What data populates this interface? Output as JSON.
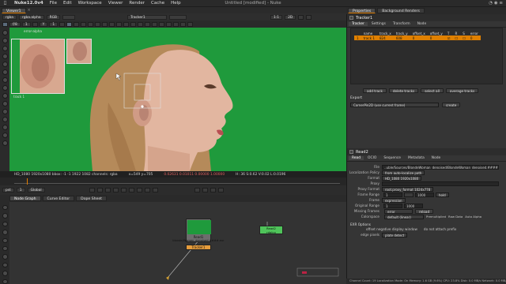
{
  "mac": {
    "app": "Nuke12.0v4",
    "menus": [
      "File",
      "Edit",
      "Workspace",
      "Viewer",
      "Render",
      "Cache",
      "Help"
    ],
    "window_title": "Untitled [modified] - Nuke"
  },
  "viewer": {
    "tab": "Viewer1",
    "channels": "rgba",
    "alpha": "rgba.alpha",
    "rgb": "RGB",
    "view_input": "Tracker1",
    "zoom": "1:1",
    "gamma": "f/8",
    "exposure": "1",
    "gain_label": "Y",
    "gain_value": "1",
    "error_label": "error-alpha",
    "info": [
      "HD_1080 1920x1080  bbox: -1 -1 1922 1082 channels: rgba",
      "x=549 y=705",
      "0.02631 0.01011 0.00000 1.00000",
      "H: 36 S:0.62 V:0.02 L:0.0196"
    ],
    "track_label": "track 1",
    "frame_label": "pst",
    "range": "Global",
    "frame": "1"
  },
  "nodegraph": {
    "tabs": [
      "Node Graph",
      "Curve Editor",
      "Dope Sheet"
    ],
    "read_node": {
      "label": "Read1",
      "sub": "blonde/Women_denoised.####.exr"
    },
    "tracker_node": "Tracker1",
    "viewer_node": {
      "label": "Read2",
      "sub": "rdalco"
    }
  },
  "properties": {
    "tabs": [
      "Properties",
      "Background Renders"
    ],
    "tracker": {
      "name": "Tracker1",
      "subtabs": [
        "Tracker",
        "Settings",
        "Transform",
        "Node"
      ],
      "columns": [
        "",
        "name",
        "track_x",
        "track_y",
        "offset_x",
        "offset_y",
        "T",
        "R",
        "S",
        "error"
      ],
      "rows": [
        {
          "n": "1",
          "name": "track 1",
          "tx": "824",
          "ty": "608",
          "ox": "0",
          "oy": "0",
          "err": "0"
        }
      ],
      "buttons": [
        "add track",
        "delete tracks",
        "select all",
        "average tracks"
      ],
      "export_label": "Export",
      "export_value": "CornerPin2D (use current frame)",
      "create": "create"
    },
    "read": {
      "name": "Read2",
      "subtabs": [
        "Read",
        "OCIO",
        "Sequence",
        "Metadata",
        "Node"
      ],
      "fields": [
        {
          "label": "File",
          "value": "..uble/Sources/BlondeWoman_denoised/BlondeWoman_denoised.####.exr"
        },
        {
          "label": "Localization Policy",
          "value": "from auto-localize path"
        },
        {
          "label": "Format",
          "value": "HD_1080 1920x1080"
        },
        {
          "label": "Proxy",
          "value": ""
        },
        {
          "label": "Proxy Format",
          "value": "root.proxy_format 1024x778"
        },
        {
          "label": "Frame Range",
          "value": "1",
          "value2": "1000",
          "value3": "hold"
        },
        {
          "label": "Frame",
          "value": "expression"
        },
        {
          "label": "Original Range",
          "value": "1",
          "value2": "1000"
        },
        {
          "label": "Missing Frames",
          "value": "error",
          "value2": "reload"
        },
        {
          "label": "Colorspace",
          "value": "default (linear)",
          "extra": [
            "Premultiplied",
            "Raw Data",
            "Auto Alpha"
          ]
        }
      ],
      "exr_label": "EXR Options",
      "exr_opt1": "offset negative display window",
      "exr_opt2": "do not attach prefix",
      "edge_label": "edge pixels",
      "edge_value": "plate detect"
    }
  },
  "status": "Channel Count: 19  Localization Mode: On  Memory: 1.6 GB (9.6%)  CPU: 23.8%  Disk: 0.0 MB/s  Network: 0.0 MB/s",
  "colors": {
    "green_screen": "#1f9a3c",
    "accent": "#e07c00"
  }
}
